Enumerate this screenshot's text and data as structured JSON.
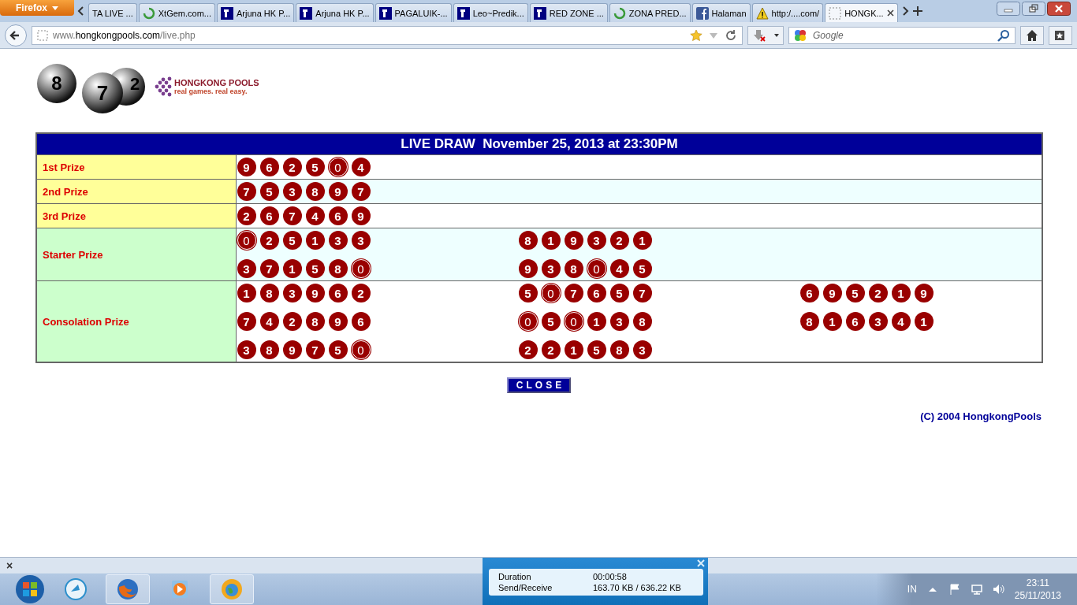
{
  "browser": {
    "menu_button": "Firefox",
    "tabs": [
      {
        "label": "TA LIVE ...",
        "kind": "plain",
        "selected": false
      },
      {
        "label": "XtGem.com...",
        "kind": "loading",
        "selected": false
      },
      {
        "label": "Arjuna HK P...",
        "kind": "letter",
        "selected": false
      },
      {
        "label": "Arjuna HK P...",
        "kind": "letter",
        "selected": false
      },
      {
        "label": "PAGALUIK-...",
        "kind": "letter",
        "selected": false
      },
      {
        "label": "Leo~Predik...",
        "kind": "letter",
        "selected": false
      },
      {
        "label": "RED ZONE ...",
        "kind": "letter",
        "selected": false
      },
      {
        "label": "ZONA PRED...",
        "kind": "loading",
        "selected": false
      },
      {
        "label": "Halaman",
        "kind": "social",
        "selected": false
      },
      {
        "label": "http:/....com/",
        "kind": "warning",
        "selected": false
      },
      {
        "label": "HONGK...",
        "kind": "blank",
        "selected": true
      }
    ],
    "url": {
      "prefix": "www.",
      "host": "hongkongpools.com",
      "path": "/live.php"
    },
    "search": {
      "placeholder": "Google"
    }
  },
  "page": {
    "logo": {
      "balls": [
        "8",
        "7",
        "2"
      ],
      "name": "HONGKONG POOLS",
      "slogan": "real games. real easy."
    },
    "title": "LIVE DRAW  November 25, 2013 at 23:30PM",
    "prizes": [
      {
        "label": "1st Prize",
        "color": "#ffff99",
        "columns": [
          [
            [
              "9",
              "6",
              "2",
              "5",
              "0",
              "4"
            ]
          ]
        ]
      },
      {
        "label": "2nd Prize",
        "color": "#ffff99",
        "columns": [
          [
            [
              "7",
              "5",
              "3",
              "8",
              "9",
              "7"
            ]
          ]
        ]
      },
      {
        "label": "3rd Prize",
        "color": "#ffff99",
        "columns": [
          [
            [
              "2",
              "6",
              "7",
              "4",
              "6",
              "9"
            ]
          ]
        ]
      },
      {
        "label": "Starter Prize",
        "color": "#ccffcc",
        "columns": [
          [
            [
              "0",
              "2",
              "5",
              "1",
              "3",
              "3"
            ],
            [
              "3",
              "7",
              "1",
              "5",
              "8",
              "0"
            ]
          ],
          [
            [
              "8",
              "1",
              "9",
              "3",
              "2",
              "1"
            ],
            [
              "9",
              "3",
              "8",
              "0",
              "4",
              "5"
            ]
          ]
        ]
      },
      {
        "label": "Consolation Prize",
        "color": "#ccffcc",
        "columns": [
          [
            [
              "1",
              "8",
              "3",
              "9",
              "6",
              "2"
            ],
            [
              "7",
              "4",
              "2",
              "8",
              "9",
              "6"
            ],
            [
              "3",
              "8",
              "9",
              "7",
              "5",
              "0"
            ]
          ],
          [
            [
              "5",
              "0",
              "7",
              "6",
              "5",
              "7"
            ],
            [
              "0",
              "5",
              "0",
              "1",
              "3",
              "8"
            ],
            [
              "2",
              "2",
              "1",
              "5",
              "8",
              "3"
            ]
          ],
          [
            [
              "6",
              "9",
              "5",
              "2",
              "1",
              "9"
            ],
            [
              "8",
              "1",
              "6",
              "3",
              "4",
              "1"
            ]
          ]
        ]
      }
    ],
    "close_button": "CLOSE",
    "copyright": "(C) 2004 HongkongPools"
  },
  "find_bar": {
    "close": "×"
  },
  "transfer_popup": {
    "rows": [
      {
        "label": "Duration",
        "value": "00:00:58"
      },
      {
        "label": "Send/Receive",
        "value": "163.70 KB / 636.22 KB"
      }
    ]
  },
  "taskbar": {
    "language": "IN",
    "time": "23:11",
    "date": "25/11/2013"
  }
}
